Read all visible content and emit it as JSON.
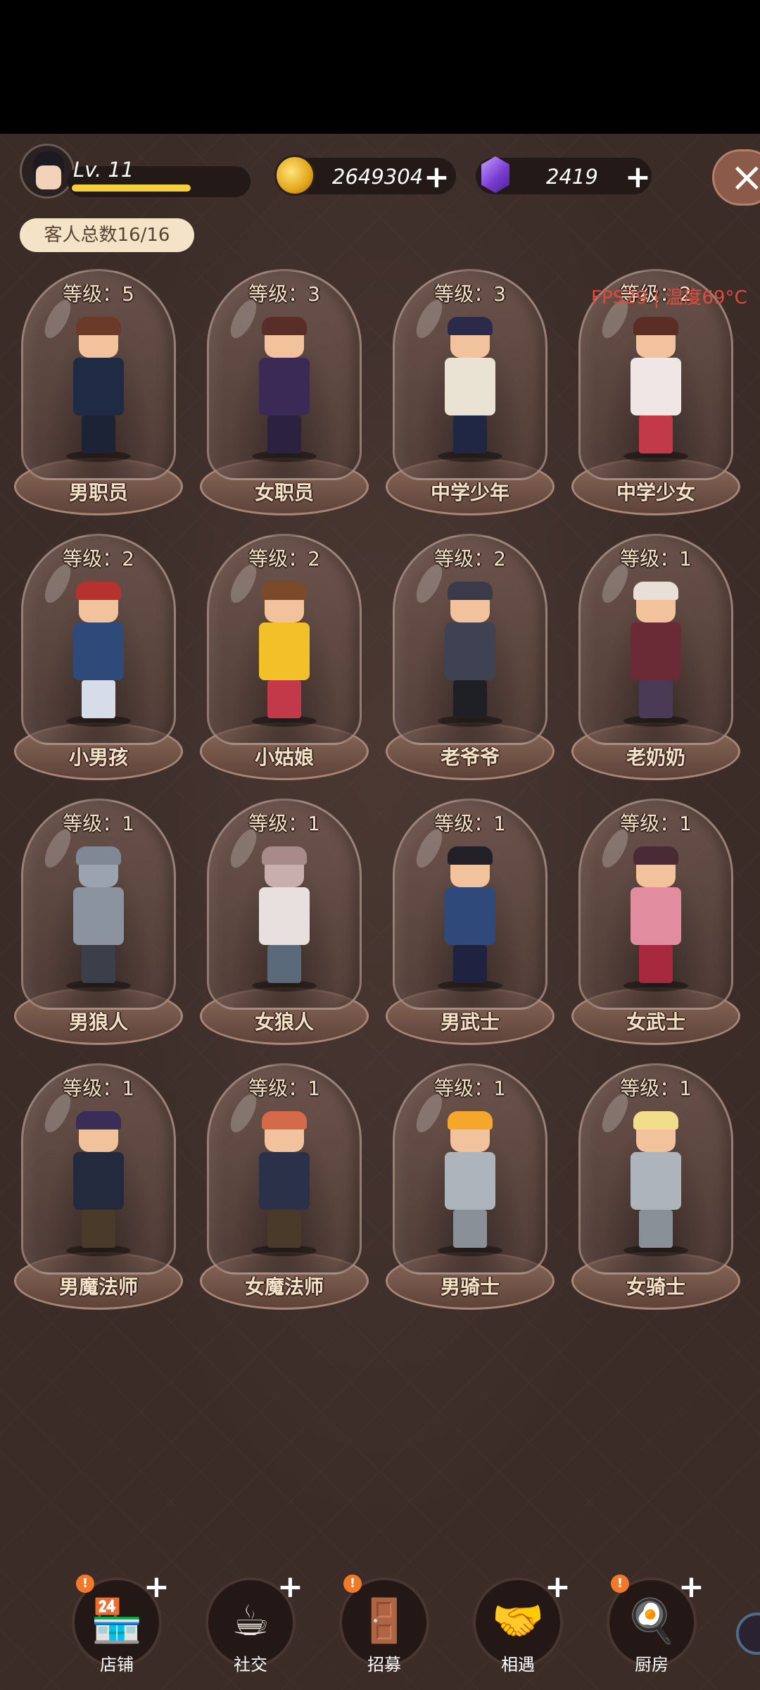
{
  "header": {
    "level_text": "Lv. 11",
    "level_progress": 0.68,
    "coins": "2649304",
    "gems": "2419",
    "plus": "+",
    "close": "×"
  },
  "guest_count": "客人总数16/16",
  "fps_overlay": "FPS29 | 温度69°C",
  "colors": {
    "accent_gold": "#f6cf3c",
    "background": "#3b2c28",
    "alert": "#f07a2a",
    "fps_text": "#e04a3a"
  },
  "characters": [
    {
      "level": "等级：5",
      "name": "男职员",
      "hair": "#6b3a28",
      "skin": "#f2c29c",
      "top": "#1f2a44",
      "legs": "#1c2336"
    },
    {
      "level": "等级：3",
      "name": "女职员",
      "hair": "#5a2e28",
      "skin": "#f2c29c",
      "top": "#3a2a55",
      "legs": "#2a2240"
    },
    {
      "level": "等级：3",
      "name": "中学少年",
      "hair": "#2b2a4a",
      "skin": "#f2c29c",
      "top": "#eae2d2",
      "legs": "#1f2744"
    },
    {
      "level": "等级：2",
      "name": "中学少女",
      "hair": "#5a2e24",
      "skin": "#f2c29c",
      "top": "#f1e6e6",
      "legs": "#c23a4a"
    },
    {
      "level": "等级：2",
      "name": "小男孩",
      "hair": "#b5322e",
      "skin": "#f2c29c",
      "top": "#2d4a78",
      "legs": "#d7dde8"
    },
    {
      "level": "等级：2",
      "name": "小姑娘",
      "hair": "#7a4a2a",
      "skin": "#f2c29c",
      "top": "#f2c12a",
      "legs": "#c23a4a"
    },
    {
      "level": "等级：2",
      "name": "老爷爷",
      "hair": "#3a3a4a",
      "skin": "#f2c29c",
      "top": "#3f4252",
      "legs": "#1f1f26"
    },
    {
      "level": "等级：1",
      "name": "老奶奶",
      "hair": "#e8e0d6",
      "skin": "#f2c29c",
      "top": "#6a2a36",
      "legs": "#4a3a55"
    },
    {
      "level": "等级：1",
      "name": "男狼人",
      "hair": "#7f8894",
      "skin": "#9aa3ae",
      "top": "#8a939e",
      "legs": "#3a3f4a"
    },
    {
      "level": "等级：1",
      "name": "女狼人",
      "hair": "#a88a8a",
      "skin": "#c9aeae",
      "top": "#e8e0de",
      "legs": "#5a6a7a"
    },
    {
      "level": "等级：1",
      "name": "男武士",
      "hair": "#222026",
      "skin": "#f2c29c",
      "top": "#2f4a7a",
      "legs": "#1f2240"
    },
    {
      "level": "等级：1",
      "name": "女武士",
      "hair": "#4a2a34",
      "skin": "#f2c29c",
      "top": "#e28ca0",
      "legs": "#a8283e"
    },
    {
      "level": "等级：1",
      "name": "男魔法师",
      "hair": "#3a2e58",
      "skin": "#f2c29c",
      "top": "#242a3e",
      "legs": "#4a3a2a"
    },
    {
      "level": "等级：1",
      "name": "女魔法师",
      "hair": "#d46a4a",
      "skin": "#f2c29c",
      "top": "#2a3148",
      "legs": "#4a3a2a"
    },
    {
      "level": "等级：1",
      "name": "男骑士",
      "hair": "#f4a72a",
      "skin": "#f2c29c",
      "top": "#aeb4bc",
      "legs": "#8a9098"
    },
    {
      "level": "等级：1",
      "name": "女骑士",
      "hair": "#f2dd8a",
      "skin": "#f2c29c",
      "top": "#aeb4bc",
      "legs": "#8a9098"
    }
  ],
  "nav": [
    {
      "label": "店铺",
      "icon": "shop-icon",
      "glyph": "🏪",
      "alert": "!",
      "has_alert": true,
      "has_plus": true
    },
    {
      "label": "社交",
      "icon": "coffee-cup-icon",
      "glyph": "☕",
      "alert": "",
      "has_alert": false,
      "has_plus": true
    },
    {
      "label": "招募",
      "icon": "door-icon",
      "glyph": "🚪",
      "alert": "!",
      "has_alert": true,
      "has_plus": false
    },
    {
      "label": "相遇",
      "icon": "handshake-icon",
      "glyph": "🤝",
      "alert": "",
      "has_alert": false,
      "has_plus": true
    },
    {
      "label": "厨房",
      "icon": "frying-pan-icon",
      "glyph": "🍳",
      "alert": "!",
      "has_alert": true,
      "has_plus": true
    }
  ]
}
